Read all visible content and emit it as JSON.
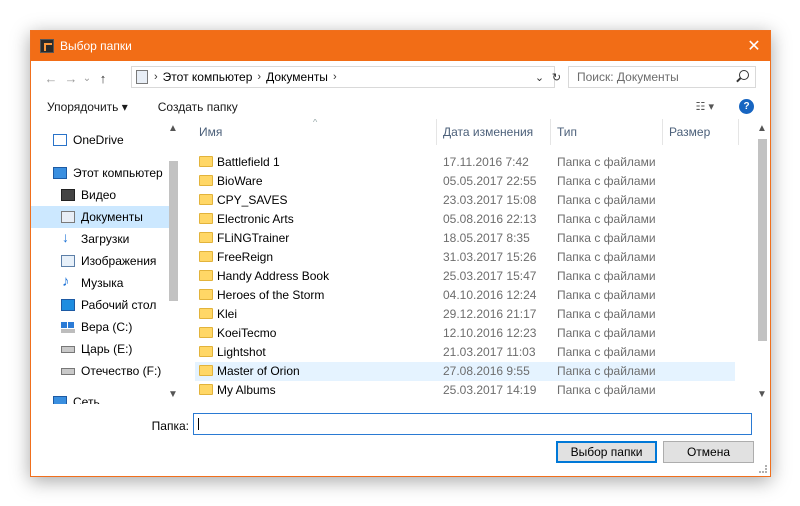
{
  "window": {
    "title": "Выбор папки",
    "close_glyph": "✕"
  },
  "addressbar": {
    "back_glyph": "←",
    "forward_glyph": "→",
    "recent_glyph": "⌄",
    "up_glyph": "↑",
    "separator": "›",
    "breadcrumbs": [
      "Этот компьютер",
      "Документы"
    ],
    "dropdown_glyph": "⌄",
    "refresh_glyph": "↻",
    "search_placeholder": "Поиск: Документы"
  },
  "toolbar": {
    "organize_label": "Упорядочить ▾",
    "new_folder_label": "Создать папку",
    "view_glyph": "☷ ▾",
    "help_glyph": "?"
  },
  "navigation": {
    "items": [
      {
        "label": "OneDrive",
        "icon": "onedrive-icon"
      },
      {
        "label": "Этот компьютер",
        "icon": "computer-icon"
      },
      {
        "label": "Видео",
        "icon": "video-icon"
      },
      {
        "label": "Документы",
        "icon": "documents-icon",
        "selected": true
      },
      {
        "label": "Загрузки",
        "icon": "downloads-icon"
      },
      {
        "label": "Изображения",
        "icon": "pictures-icon"
      },
      {
        "label": "Музыка",
        "icon": "music-icon"
      },
      {
        "label": "Рабочий стол",
        "icon": "desktop-icon"
      },
      {
        "label": "Вера (C:)",
        "icon": "windows-drive-icon"
      },
      {
        "label": "Царь (E:)",
        "icon": "drive-icon"
      },
      {
        "label": "Отечество (F:)",
        "icon": "drive-icon"
      },
      {
        "label": "Сеть",
        "icon": "network-icon"
      }
    ],
    "scroll_up_glyph": "▲",
    "scroll_down_glyph": "▼"
  },
  "file_list": {
    "columns": {
      "name": "Имя",
      "date": "Дата изменения",
      "type": "Тип",
      "size": "Размер"
    },
    "sort_glyph": "^",
    "rows": [
      {
        "name": "Battlefield 1",
        "date": "17.11.2016 7:42",
        "type": "Папка с файлами"
      },
      {
        "name": "BioWare",
        "date": "05.05.2017 22:55",
        "type": "Папка с файлами"
      },
      {
        "name": "CPY_SAVES",
        "date": "23.03.2017 15:08",
        "type": "Папка с файлами"
      },
      {
        "name": "Electronic Arts",
        "date": "05.08.2016 22:13",
        "type": "Папка с файлами"
      },
      {
        "name": "FLiNGTrainer",
        "date": "18.05.2017 8:35",
        "type": "Папка с файлами"
      },
      {
        "name": "FreeReign",
        "date": "31.03.2017 15:26",
        "type": "Папка с файлами"
      },
      {
        "name": "Handy Address Book",
        "date": "25.03.2017 15:47",
        "type": "Папка с файлами"
      },
      {
        "name": "Heroes of the Storm",
        "date": "04.10.2016 12:24",
        "type": "Папка с файлами"
      },
      {
        "name": "Klei",
        "date": "29.12.2016 21:17",
        "type": "Папка с файлами"
      },
      {
        "name": "KoeiTecmo",
        "date": "12.10.2016 12:23",
        "type": "Папка с файлами"
      },
      {
        "name": "Lightshot",
        "date": "21.03.2017 11:03",
        "type": "Папка с файлами"
      },
      {
        "name": "Master of Orion",
        "date": "27.08.2016 9:55",
        "type": "Папка с файлами",
        "hover": true
      },
      {
        "name": "My Albums",
        "date": "25.03.2017 14:19",
        "type": "Папка с файлами"
      }
    ],
    "scroll_up_glyph": "▲",
    "scroll_down_glyph": "▼"
  },
  "footer": {
    "folder_label": "Папка:",
    "folder_value": "",
    "select_button": "Выбор папки",
    "cancel_button": "Отмена"
  },
  "colors": {
    "titlebar": "#f26d16",
    "selection": "#cce8ff",
    "hover": "#e5f3ff",
    "accent": "#0078d7"
  }
}
